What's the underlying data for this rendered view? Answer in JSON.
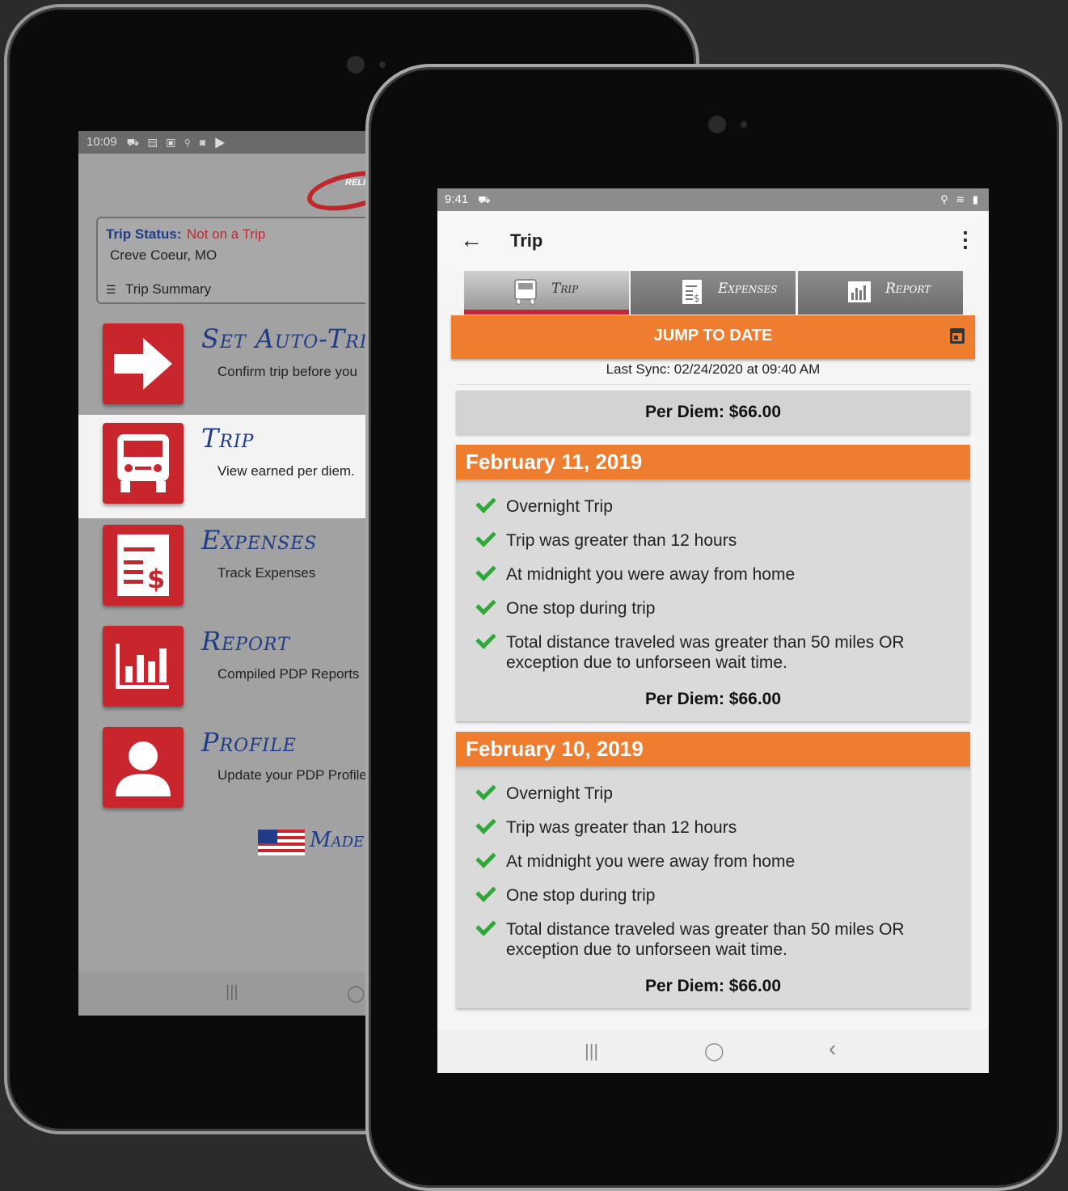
{
  "back_tablet": {
    "status_bar": {
      "time": "10:09",
      "icons": "⛟ ▤ ▣ ⚲ ◙ ▶"
    },
    "logo_text": "RELIA",
    "trip_status": {
      "label": "Trip Status:",
      "value": "Not on a Trip",
      "location": "Creve Coeur, MO",
      "summary_label": "Trip Summary"
    },
    "menu": [
      {
        "title": "Set Auto-Trip",
        "subtitle": "Confirm trip before you"
      },
      {
        "title": "Trip",
        "subtitle": "View earned per diem."
      },
      {
        "title": "Expenses",
        "subtitle": "Track Expenses"
      },
      {
        "title": "Report",
        "subtitle": "Compiled PDP Reports"
      },
      {
        "title": "Profile",
        "subtitle": "Update your PDP Profile"
      }
    ],
    "made_in": "Made in",
    "nav": {
      "recents": "|||",
      "home": "◯"
    }
  },
  "front_tablet": {
    "status_bar": {
      "time": "9:41",
      "right_icons": "⚲ ≋ ▮"
    },
    "appbar": {
      "back": "←",
      "title": "Trip",
      "menu": "⋮"
    },
    "tabs": [
      {
        "label": "Trip",
        "icon": "truck-icon",
        "active": true
      },
      {
        "label": "Expenses",
        "icon": "receipt-icon",
        "active": false
      },
      {
        "label": "Report",
        "icon": "bar-chart-icon",
        "active": false
      }
    ],
    "jump_to_date": "JUMP TO DATE",
    "last_sync": "Last Sync: 02/24/2020 at 09:40 AM",
    "per_diem_total": "Per Diem: $66.00",
    "days": [
      {
        "date": "February 11, 2019",
        "criteria": [
          "Overnight Trip",
          "Trip was greater than 12 hours",
          "At midnight you were away from home",
          "One stop during trip",
          "Total distance traveled was greater than 50 miles OR exception due to unforseen wait time."
        ],
        "per_diem": "Per Diem: $66.00"
      },
      {
        "date": "February 10, 2019",
        "criteria": [
          "Overnight Trip",
          "Trip was greater than 12 hours",
          "At midnight you were away from home",
          "One stop during trip",
          "Total distance traveled was greater than 50 miles OR exception due to unforseen wait time."
        ],
        "per_diem": "Per Diem: $66.00"
      }
    ],
    "nav": {
      "recents": "|||",
      "home": "◯",
      "back": "‹"
    }
  },
  "colors": {
    "brand_red": "#c8262c",
    "brand_blue": "#1f3c88",
    "accent_orange": "#ef7d30",
    "check_green": "#2fa83a"
  }
}
